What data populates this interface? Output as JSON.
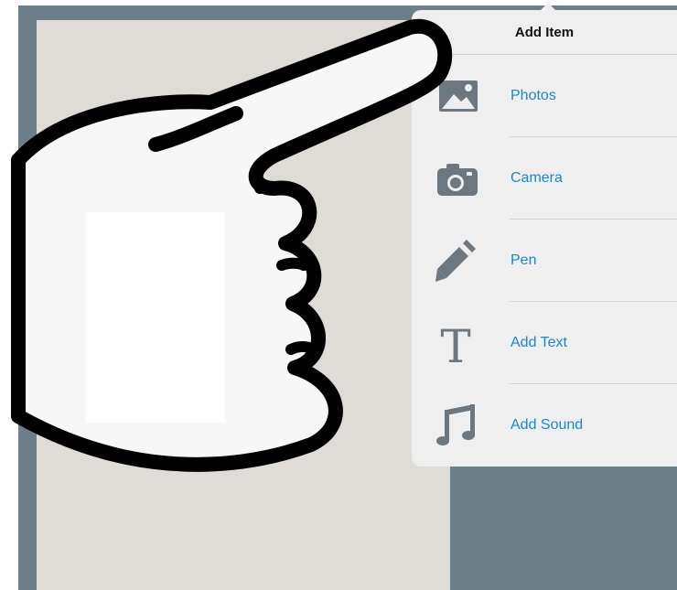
{
  "popover": {
    "title": "Add Item",
    "items": [
      {
        "label": "Photos",
        "icon": "photo-icon"
      },
      {
        "label": "Camera",
        "icon": "camera-icon"
      },
      {
        "label": "Pen",
        "icon": "pen-icon"
      },
      {
        "label": "Add Text",
        "icon": "text-icon"
      },
      {
        "label": "Add Sound",
        "icon": "music-note-icon"
      }
    ]
  },
  "colors": {
    "background": "#6d7f89",
    "canvas": "#dfdcd7",
    "popover": "#efefef",
    "link": "#1b87c9",
    "icon": "#6c7780"
  }
}
